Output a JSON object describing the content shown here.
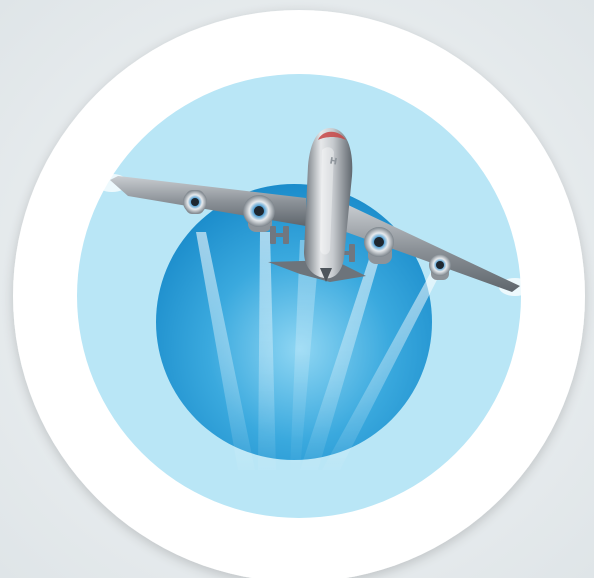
{
  "colors": {
    "background": "#e9eef0",
    "badge_white": "#ffffff",
    "sky_light": "#b9e6f6",
    "globe_light": "#7fcdef",
    "globe_mid": "#3aa9de",
    "globe_dark": "#1b8ccb",
    "plane_silver_light": "#e6e8ea",
    "plane_silver_mid": "#a7acb1",
    "plane_silver_dark": "#5f666d",
    "nose_red": "#c84545",
    "engine_blue": "#5aa4d6"
  },
  "badge": {
    "shape": "circle",
    "icon": "airplane-icon",
    "globe": "globe-icon"
  },
  "tail_letters": {
    "left": "H",
    "right": "H"
  }
}
